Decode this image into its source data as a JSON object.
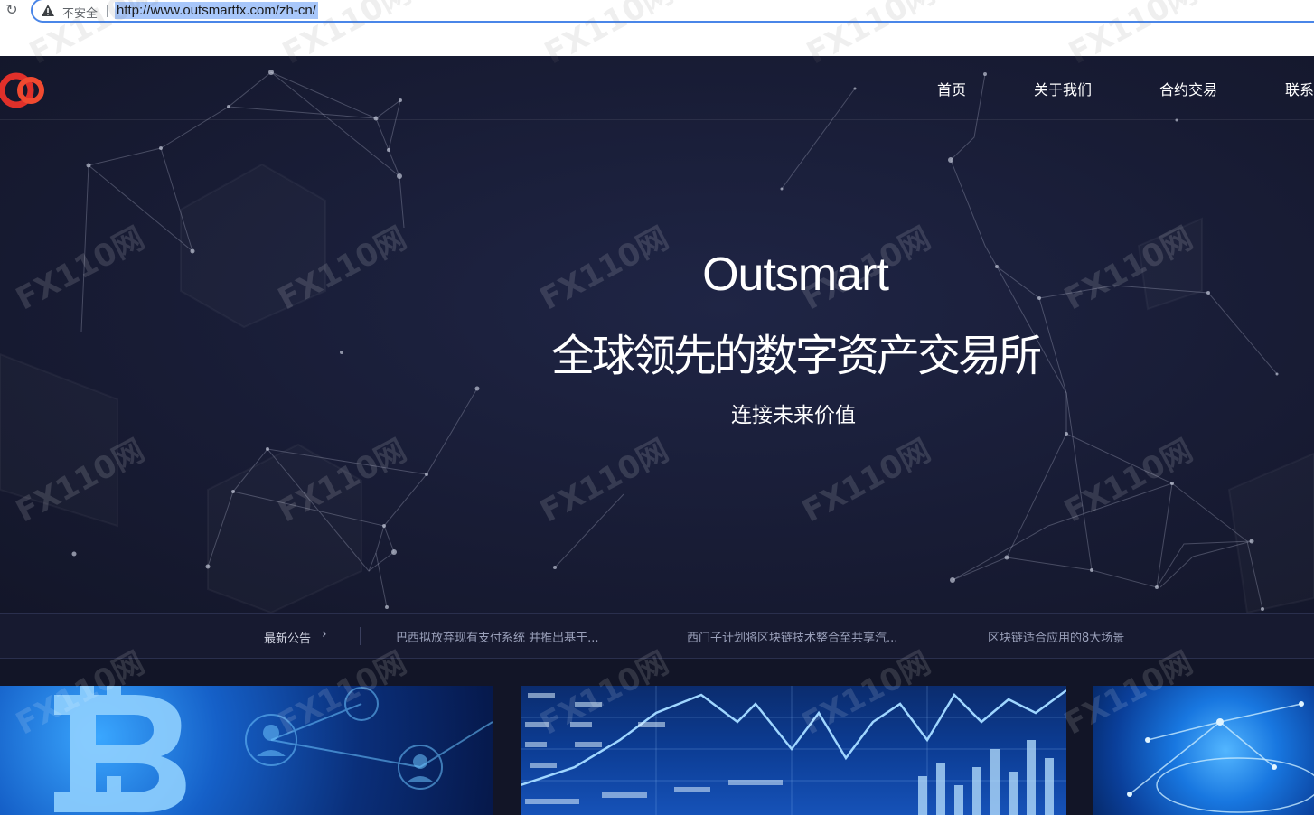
{
  "browser": {
    "security_label": "不安全",
    "url": "http://www.outsmartfx.com/zh-cn/"
  },
  "nav": {
    "items": [
      "首页",
      "关于我们",
      "合约交易",
      "联系"
    ]
  },
  "hero": {
    "brand": "Outsmart",
    "headline": "全球领先的数字资产交易所",
    "tagline": "连接未来价值"
  },
  "announcements": {
    "label": "最新公告",
    "items": [
      "巴西拟放弃现有支付系统 并推出基于...",
      "西门子计划将区块链技术整合至共享汽...",
      "区块链适合应用的8大场景"
    ]
  },
  "watermark": "FX110网",
  "colors": {
    "hero_bg": "#181c35",
    "accent_red": "#e0302a",
    "address_highlight": "#a8c7fa"
  }
}
